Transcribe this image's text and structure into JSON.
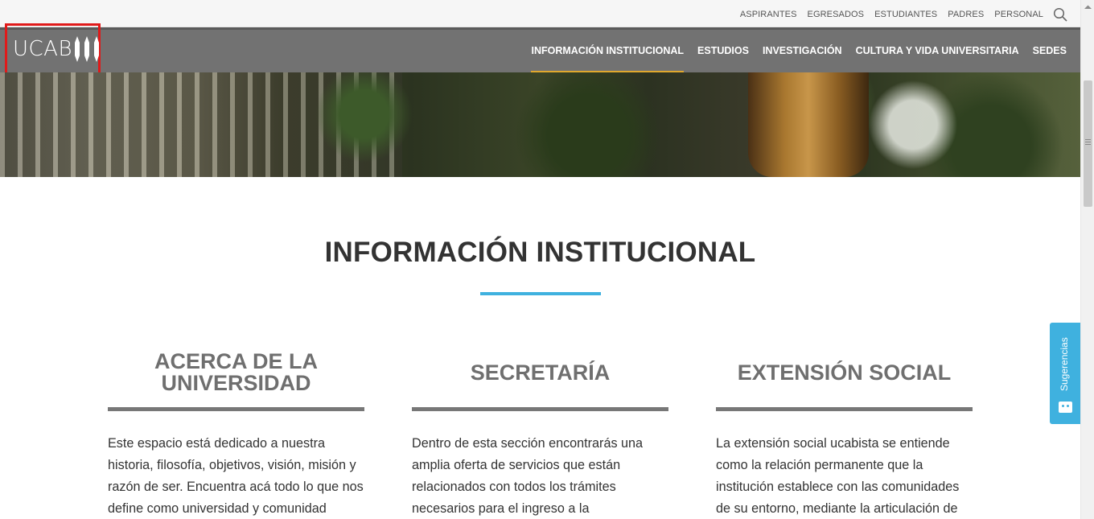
{
  "topbar": {
    "links": [
      "ASPIRANTES",
      "EGRESADOS",
      "ESTUDIANTES",
      "PADRES",
      "PERSONAL"
    ],
    "search_icon": "search-icon"
  },
  "nav": {
    "logo_text": "UCAB",
    "items": [
      "INFORMACIÓN INSTITUCIONAL",
      "ESTUDIOS",
      "INVESTIGACIÓN",
      "CULTURA Y VIDA UNIVERSITARIA",
      "SEDES"
    ],
    "active_item": "INFORMACIÓN INSTITUCIONAL"
  },
  "page": {
    "title": "INFORMACIÓN INSTITUCIONAL"
  },
  "columns": [
    {
      "heading": "ACERCA DE LA UNIVERSIDAD",
      "text": "Este espacio está dedicado a nuestra historia, filosofía, objetivos, visión, misión y razón de ser. Encuentra acá todo lo que nos define como universidad y comunidad"
    },
    {
      "heading": "SECRETARÍA",
      "text": "Dentro de esta sección encontrarás una amplia oferta de servicios que están relacionados con todos los trámites necesarios para el ingreso a la"
    },
    {
      "heading": "EXTENSIÓN SOCIAL",
      "text": "La extensión social ucabista se entiende como la relación permanente que la institución establece con las comunidades de su entorno, mediante la articulación de"
    }
  ],
  "feedback": {
    "label": "Sugerencias"
  },
  "colors": {
    "accent": "#3fb1df",
    "nav_bg": "#727272",
    "active_underline": "#e0a82e",
    "logo_highlight": "#e01a1a"
  }
}
